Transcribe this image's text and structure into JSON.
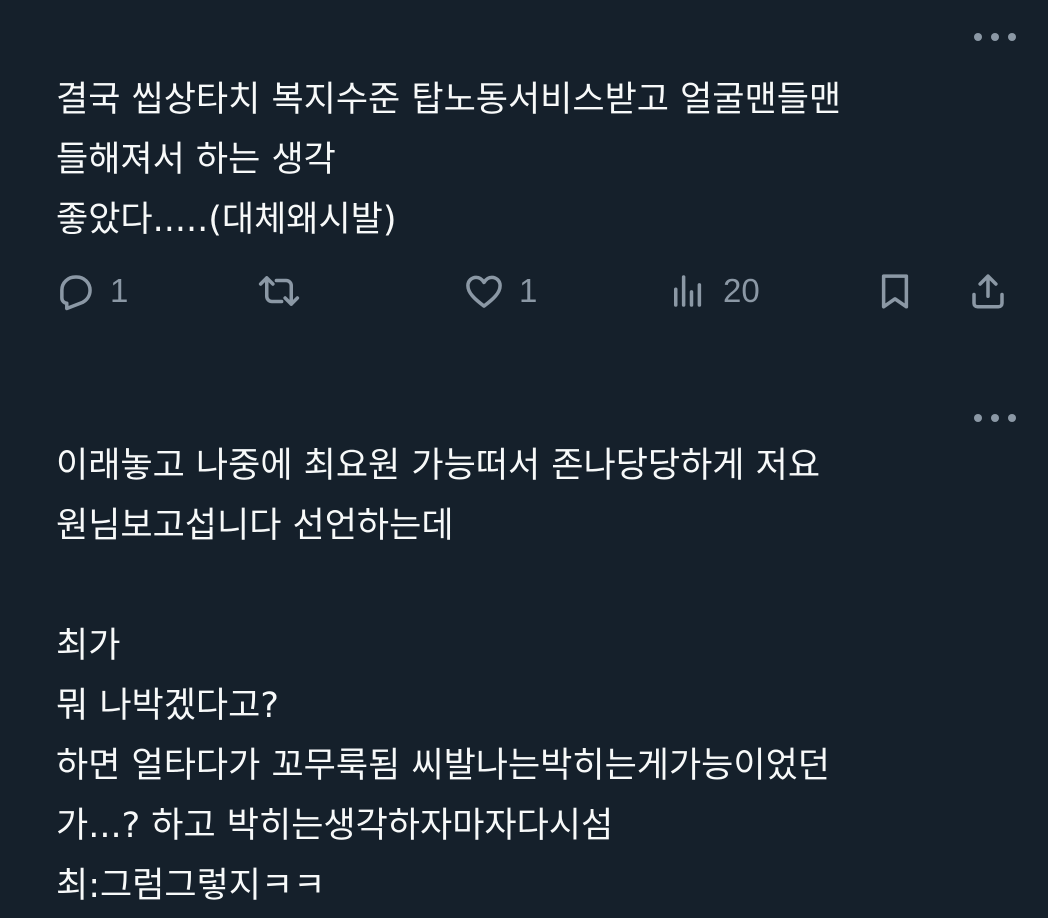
{
  "tweets": [
    {
      "text": "결국 씹상타치 복지수준 탑노동서비스받고 얼굴맨들맨\n들해져서 하는 생각\n좋았다.....(대체왜시발)",
      "replies": "1",
      "retweets": "",
      "likes": "1",
      "views": "20"
    },
    {
      "text": "이래놓고 나중에 최요원 가능떠서 존나당당하게 저요\n원님보고섭니다 선언하는데\n\n최가\n뭐 나박겠다고?\n하면 얼타다가 꼬무룩됨 씨발나는박히는게가능이었던\n가...? 하고 박히는생각하자마자다시섬\n최:그럼그렇지ㅋㅋ"
    }
  ],
  "icons": {
    "more": "more-horizontal-icon",
    "reply": "reply-icon",
    "retweet": "retweet-icon",
    "like": "heart-icon",
    "views": "analytics-icon",
    "bookmark": "bookmark-icon",
    "share": "share-icon"
  },
  "colors": {
    "background": "#15202b",
    "text": "#f7f9f9",
    "secondary": "#8b98a5"
  }
}
